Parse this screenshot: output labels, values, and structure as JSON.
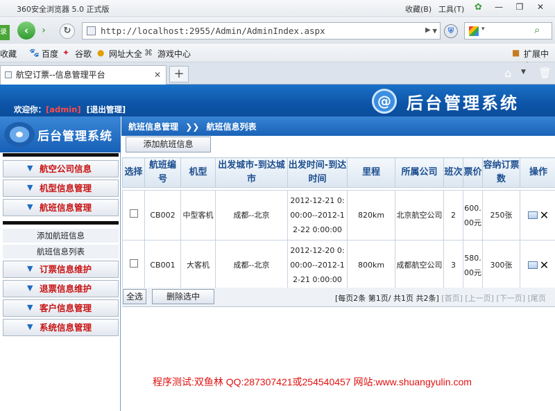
{
  "browser": {
    "title": "360安全浏览器 5.0 正式版",
    "fav_label": "收藏(B)",
    "tools_label": "工具(T)",
    "url": "http://localhost:2955/Admin/AdminIndex.aspx",
    "side_login": "录",
    "tab_title": "航空订票--信息管理平台",
    "bookmarks": {
      "fav": "收藏",
      "baidu": "百度",
      "google": "谷歌",
      "webnav": "网址大全",
      "games": "游戏中心",
      "ext": "扩展中心"
    }
  },
  "header": {
    "welcome": "欢迎你：",
    "username": "[admin]",
    "logout": "[退出管理]",
    "system_title": "后台管理系统"
  },
  "sidebar": {
    "brand": "后台管理系统",
    "top_items": [
      "航空公司信息",
      "机型信息管理",
      "航班信息管理"
    ],
    "sub_items": [
      "添加航班信息",
      "航班信息列表"
    ],
    "bottom_items": [
      "订票信息维护",
      "退票信息维护",
      "客户信息管理",
      "系统信息管理"
    ]
  },
  "main": {
    "crumb1": "航班信息管理",
    "crumb2": "航班信息列表",
    "add_button": "添加航班信息",
    "columns": [
      "选择",
      "航班编号",
      "机型",
      "出发城市-到达城市",
      "出发时间-到达时间",
      "里程",
      "所属公司",
      "班次",
      "票价",
      "容纳订票数",
      "操作"
    ],
    "rows": [
      {
        "code": "CB002",
        "type": "中型客机",
        "route": "成都--北京",
        "time": "2012-12-21 0:00:00--2012-12-22 0:00:00",
        "distance": "820km",
        "company": "北京航空公司",
        "trips": "2",
        "price": "600.00元",
        "seats": "250张"
      },
      {
        "code": "CB001",
        "type": "大客机",
        "route": "成都--北京",
        "time": "2012-12-20 0:00:00--2012-12-21 0:00:00",
        "distance": "800km",
        "company": "成都航空公司",
        "trips": "3",
        "price": "580.00元",
        "seats": "300张"
      }
    ],
    "select_all": "全选",
    "delete_selected": "删除选中",
    "pager": {
      "per_page": "[每页2条",
      "current": "第1页",
      "total_pages": "共1页",
      "total": "共2条]",
      "first": "[首页]",
      "prev": "[上一页]",
      "next": "[下一页]",
      "last": "[尾页"
    }
  },
  "footer": "程序测试:双鱼林  QQ:287307421或254540457 网站:www.shuangyulin.com"
}
